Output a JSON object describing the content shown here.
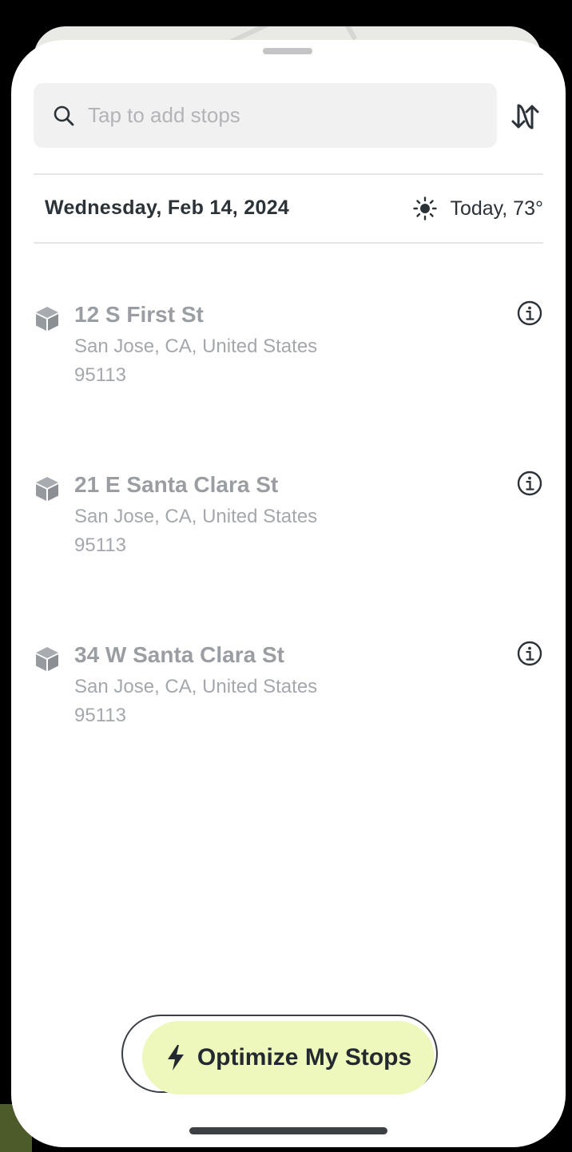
{
  "search": {
    "placeholder": "Tap to add stops",
    "icon": "search-icon"
  },
  "header": {
    "date": "Wednesday, Feb 14, 2024",
    "weather_icon": "sun-icon",
    "weather": "Today, 73°"
  },
  "stops": [
    {
      "title": "12 S First St",
      "line1": "San Jose, CA, United States",
      "line2": "95113"
    },
    {
      "title": "21 E Santa Clara St",
      "line1": "San Jose, CA, United States",
      "line2": "95113"
    },
    {
      "title": "34 W Santa Clara St",
      "line1": "San Jose, CA, United States",
      "line2": "95113"
    }
  ],
  "action": {
    "label": "Optimize My Stops",
    "icon": "bolt-icon"
  },
  "colors": {
    "accent": "#eef8bd",
    "text_dark": "#2b3238",
    "text_muted": "#9a9ea2"
  }
}
